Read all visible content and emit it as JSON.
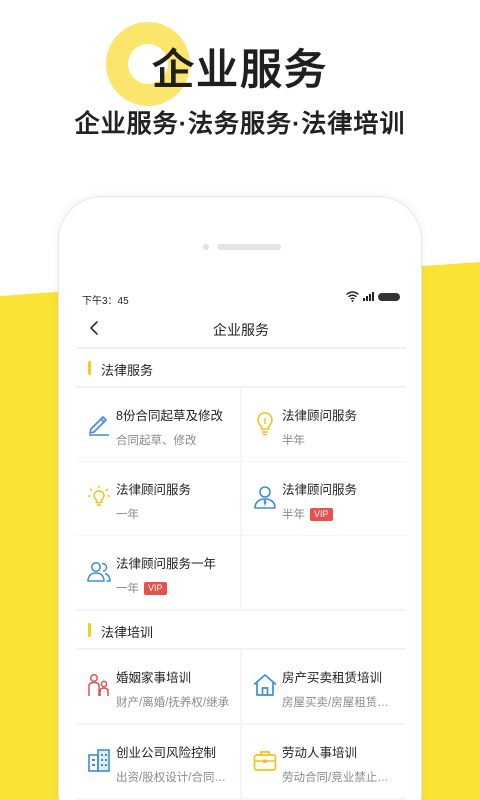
{
  "hero": {
    "title": "企业服务",
    "subtitle": "企业服务·法务服务·法律培训"
  },
  "colors": {
    "brand_yellow": "#fbe336",
    "section_accent": "#f7cd1b",
    "icon_blue": "#3c8ed6",
    "icon_yellow": "#f0c419",
    "icon_red": "#e0504b",
    "vip_red": "#e8504b"
  },
  "status_bar": {
    "time": "下午3：45",
    "icons": [
      "wifi-icon",
      "signal-icon",
      "battery-icon"
    ]
  },
  "nav": {
    "back_icon": "chevron-left-icon",
    "title": "企业服务"
  },
  "sections": [
    {
      "title": "法律服务",
      "items": [
        {
          "title": "8份合同起草及修改",
          "subtitle": "合同起草、修改",
          "icon": "pencil-icon"
        },
        {
          "title": "法律顾问服务",
          "subtitle": "半年",
          "icon": "lightbulb-icon"
        },
        {
          "title": "法律顾问服务",
          "subtitle": "一年",
          "icon": "lightbulb-glow-icon"
        },
        {
          "title": "法律顾问服务",
          "subtitle": "半年",
          "badge": "VIP",
          "icon": "user-tie-icon"
        },
        {
          "title": "法律顾问服务一年",
          "subtitle": "一年",
          "badge": "VIP",
          "icon": "users-icon"
        }
      ]
    },
    {
      "title": "法律培训",
      "items": [
        {
          "title": "婚姻家事培训",
          "subtitle": "财产/离婚/抚养权/继承",
          "icon": "family-icon"
        },
        {
          "title": "房产买卖租赁培训",
          "subtitle": "房屋买卖/房屋租赁…",
          "icon": "house-icon"
        },
        {
          "title": "创业公司风险控制",
          "subtitle": "出资/股权设计/合同…",
          "icon": "building-icon"
        },
        {
          "title": "劳动人事培训",
          "subtitle": "劳动合同/竞业禁止…",
          "icon": "briefcase-icon"
        }
      ]
    }
  ]
}
